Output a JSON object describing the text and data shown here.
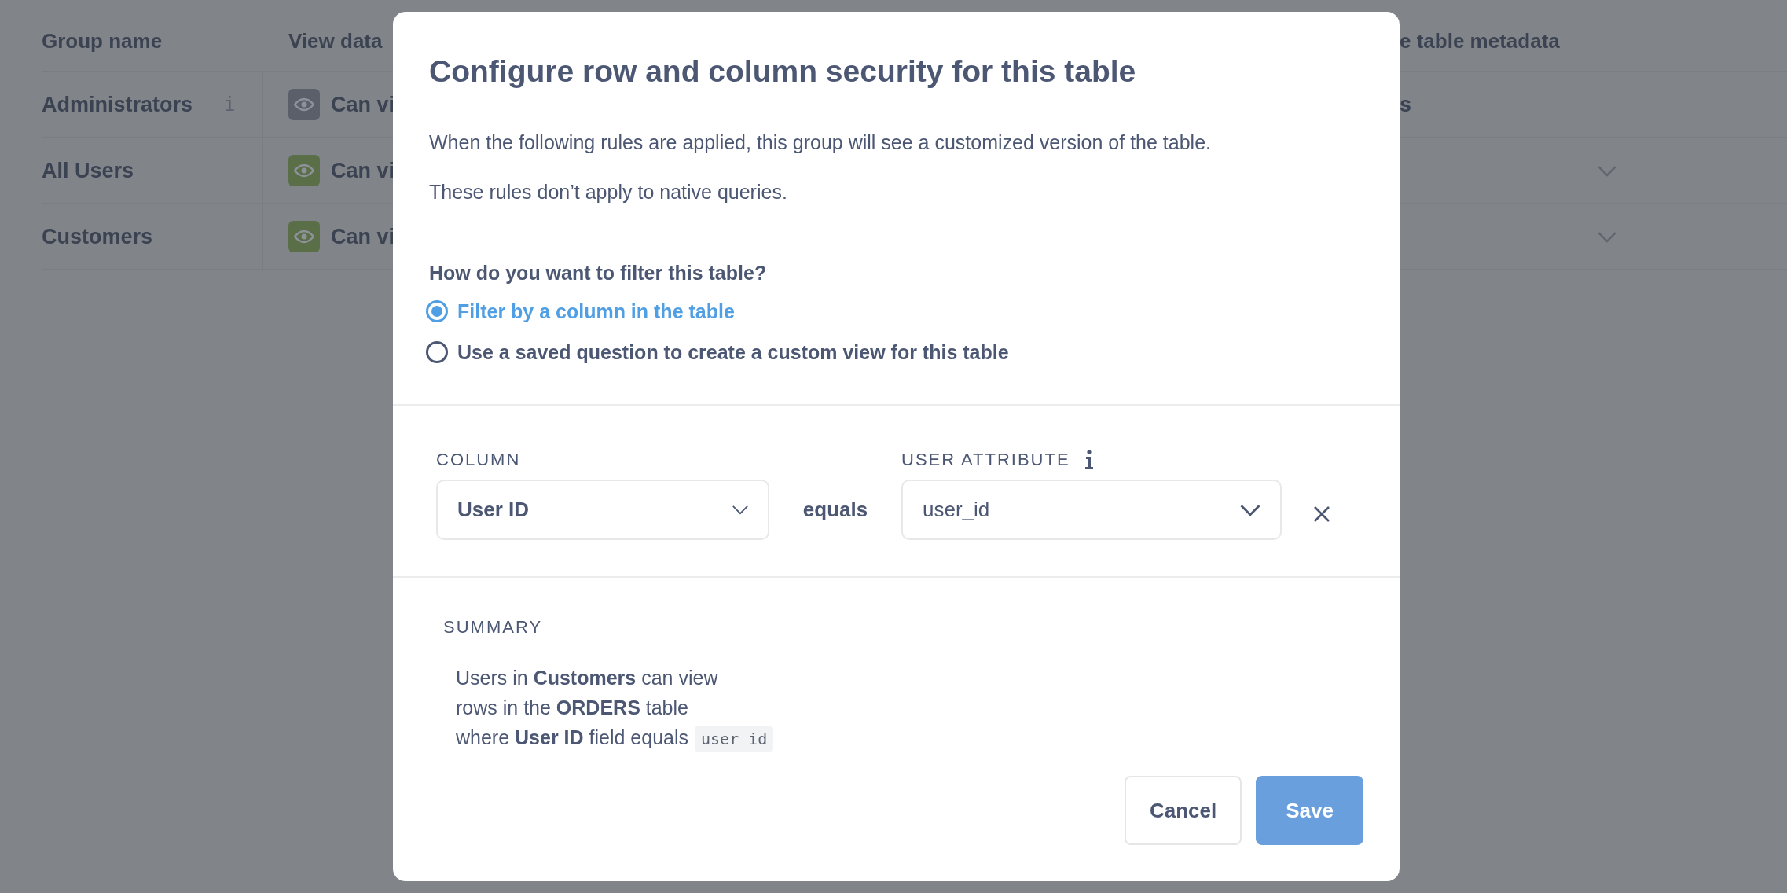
{
  "background_table": {
    "columns": [
      {
        "label": "Group name"
      },
      {
        "label": "View data"
      },
      {
        "label": "e table metadata"
      }
    ],
    "rows": [
      {
        "group": "Administrators",
        "info_mark": "i",
        "access": "Can vi",
        "color": "#5b5f6a",
        "metadata": "s",
        "dropdown": false
      },
      {
        "group": "All Users",
        "access": "Can vi",
        "color": "#5a6e47",
        "dropdown": true
      },
      {
        "group": "Customers",
        "access": "Can vi",
        "color": "#5a6e47",
        "dropdown": true
      }
    ]
  },
  "modal": {
    "title": "Configure row and column security for this table",
    "paragraphs": [
      "When the following rules are applied, this group will see a customized version of the table.",
      "These rules don’t apply to native queries."
    ],
    "question": "How do you want to filter this table?",
    "options": [
      {
        "label": "Filter by a column in the table",
        "selected": true
      },
      {
        "label": "Use a saved question to create a custom view for this table",
        "selected": false
      }
    ],
    "filter": {
      "column_label": "COLUMN",
      "column_value": "User ID",
      "operator": "equals",
      "attribute_label": "USER ATTRIBUTE",
      "attribute_value": "user_id"
    },
    "summary": {
      "label": "SUMMARY",
      "lines": [
        {
          "text": "Users in **Customers** can view"
        },
        {
          "text": "rows in the **ORDERS** table"
        },
        {
          "text": "where **User ID** field equals",
          "code": "user_id"
        }
      ]
    },
    "buttons": [
      {
        "label": "Cancel",
        "kind": "secondary"
      },
      {
        "label": "Save",
        "kind": "primary"
      }
    ]
  }
}
